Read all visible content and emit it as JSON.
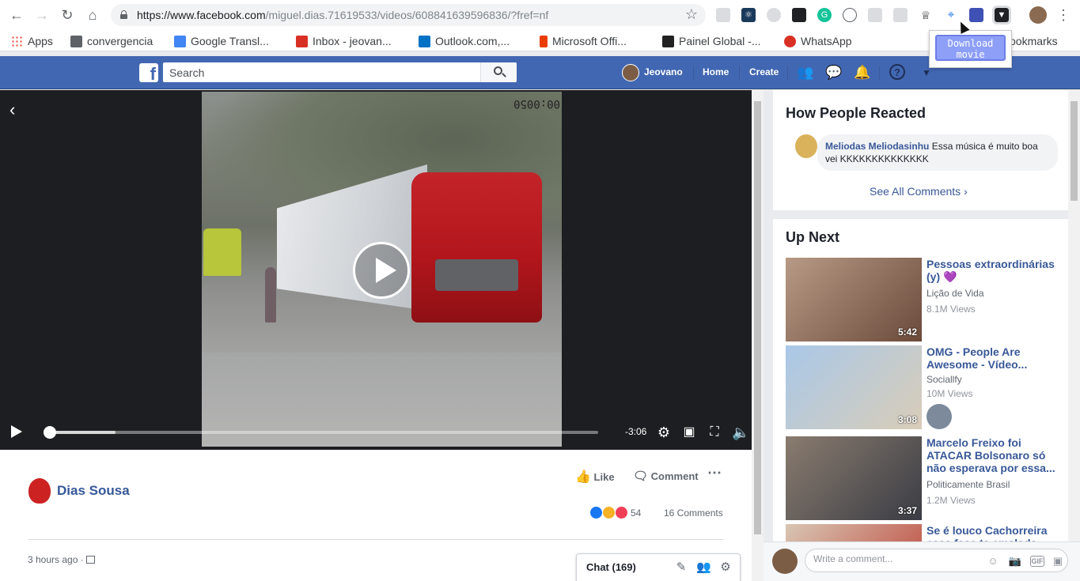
{
  "browser": {
    "url_host": "https://www.facebook.com",
    "url_path": "/miguel.dias.71619533/videos/608841639596836/?fref=nf",
    "bookmarks": [
      {
        "label": "Apps",
        "color": "#ea4335"
      },
      {
        "label": "convergencia",
        "color": "#5f6368"
      },
      {
        "label": "Google Transl...",
        "color": "#4285f4"
      },
      {
        "label": "Inbox - jeovan...",
        "color": "#d93025"
      },
      {
        "label": "Outlook.com,...",
        "color": "#0072c6"
      },
      {
        "label": "Microsoft Offi...",
        "color": "#eb3c00"
      },
      {
        "label": "Painel Global -...",
        "color": "#222222"
      },
      {
        "label": "WhatsApp",
        "color": "#d93025"
      },
      {
        "label": "ookmarks",
        "color": "#5f6368"
      }
    ],
    "download_popup_label": "Download movie"
  },
  "fb": {
    "search_placeholder": "Search",
    "user_name": "Jeovano",
    "nav_home": "Home",
    "nav_create": "Create",
    "brand_color": "#4267b2"
  },
  "player": {
    "time_remaining": "-3:06",
    "overlay_timestamp": "00:0050",
    "played_fraction": 0.0,
    "buffered_fraction": 0.13
  },
  "post": {
    "author": "Dias Sousa",
    "like_label": "Like",
    "comment_label": "Comment",
    "reaction_count": "54",
    "comments_count": "16 Comments",
    "time": "3 hours ago ·"
  },
  "chat": {
    "label": "Chat (169)"
  },
  "reacted": {
    "title": "How People Reacted",
    "comment_author": "Meliodas Meliodasinhu",
    "comment_text": "Essa música é muito boa vei KKKKKKKKKKKKKK",
    "see_all": "See All Comments"
  },
  "up_next": {
    "title": "Up Next",
    "items": [
      {
        "title": "Pessoas extraordinárias (y) 💜",
        "channel": "Lição de Vida",
        "views": "8.1M Views",
        "duration": "5:42",
        "thumb_colors": [
          "#b79a86",
          "#6b4a3a"
        ]
      },
      {
        "title": "OMG - People Are Awesome - Vídeo...",
        "channel": "Sociallfy",
        "views": "10M Views",
        "duration": "3:08",
        "thumb_colors": [
          "#a9c8e8",
          "#d9cdb8"
        ]
      },
      {
        "title": "Marcelo Freixo foi ATACAR Bolsonaro só não esperava por essa...",
        "channel": "Politicamente Brasil",
        "views": "1.2M Views",
        "duration": "3:37",
        "thumb_colors": [
          "#8a7c6f",
          "#3a3c44"
        ]
      },
      {
        "title": "Se é louco Cachorreira essa fase ta emalada",
        "channel": "",
        "views": "",
        "duration": "",
        "thumb_colors": [
          "#d9c6b4",
          "#b93a2e"
        ]
      }
    ]
  },
  "comment_box": {
    "placeholder": "Write a comment..."
  }
}
